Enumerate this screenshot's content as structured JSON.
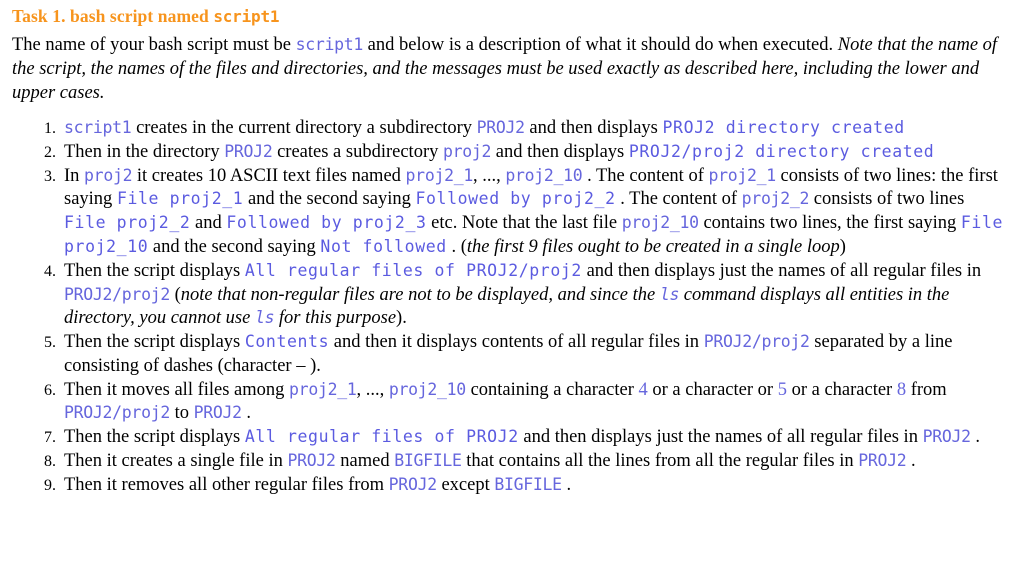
{
  "heading": {
    "prefix": "Task 1. bash script named ",
    "script_name": "script1"
  },
  "intro": {
    "seg1": "The name of your bash script must be ",
    "code1": "script1",
    "seg2": " and below is a description of what it should do when executed. ",
    "italic_note": "Note that the name of the script, the names of the files and directories, and the messages must be used exactly as described here, including the lower and upper cases."
  },
  "steps": [
    {
      "id": 1,
      "parts": [
        {
          "t": "code",
          "v": "script1"
        },
        {
          "t": "text",
          "v": " creates in the current directory a subdirectory "
        },
        {
          "t": "code",
          "v": "PROJ2"
        },
        {
          "t": "text",
          "v": " and then displays "
        },
        {
          "t": "msg",
          "v": "PROJ2 directory created"
        }
      ]
    },
    {
      "id": 2,
      "parts": [
        {
          "t": "text",
          "v": "Then in the directory "
        },
        {
          "t": "code",
          "v": "PROJ2"
        },
        {
          "t": "text",
          "v": " creates a subdirectory "
        },
        {
          "t": "code",
          "v": "proj2"
        },
        {
          "t": "text",
          "v": " and then displays "
        },
        {
          "t": "msg",
          "v": "PROJ2/proj2 directory created"
        }
      ]
    },
    {
      "id": 3,
      "parts": [
        {
          "t": "text",
          "v": "In "
        },
        {
          "t": "code",
          "v": "proj2"
        },
        {
          "t": "text",
          "v": " it creates 10 ASCII text files named "
        },
        {
          "t": "code",
          "v": "proj2_1"
        },
        {
          "t": "text",
          "v": ", ..., "
        },
        {
          "t": "code",
          "v": "proj2_10"
        },
        {
          "t": "text",
          "v": " . The content of "
        },
        {
          "t": "code",
          "v": "proj2_1"
        },
        {
          "t": "text",
          "v": " consists of two lines: the first saying "
        },
        {
          "t": "msg",
          "v": "File proj2_1"
        },
        {
          "t": "text",
          "v": " and the second saying "
        },
        {
          "t": "msg",
          "v": "Followed by proj2_2"
        },
        {
          "t": "text",
          "v": " . The content of "
        },
        {
          "t": "code",
          "v": "proj2_2"
        },
        {
          "t": "text",
          "v": " consists of two lines "
        },
        {
          "t": "msg",
          "v": "File proj2_2"
        },
        {
          "t": "text",
          "v": " and "
        },
        {
          "t": "msg",
          "v": "Followed by proj2_3"
        },
        {
          "t": "text",
          "v": " etc. Note that the last file "
        },
        {
          "t": "code",
          "v": "proj2_10"
        },
        {
          "t": "text",
          "v": " contains two lines, the first saying "
        },
        {
          "t": "msg",
          "v": "File proj2_10"
        },
        {
          "t": "text",
          "v": " and the second saying "
        },
        {
          "t": "msg",
          "v": "Not followed"
        },
        {
          "t": "text",
          "v": " . ("
        },
        {
          "t": "ital",
          "v": "the first 9 files ought to be created in a single loop"
        },
        {
          "t": "text",
          "v": ")"
        }
      ]
    },
    {
      "id": 4,
      "parts": [
        {
          "t": "text",
          "v": "Then the script displays "
        },
        {
          "t": "msg",
          "v": "All regular files of PROJ2/proj2"
        },
        {
          "t": "text",
          "v": " and then displays just the names of all regular files in "
        },
        {
          "t": "code",
          "v": "PROJ2/proj2"
        },
        {
          "t": "text",
          "v": " ("
        },
        {
          "t": "ital",
          "v": "note that non-regular files are not to be displayed, and since the "
        },
        {
          "t": "ital-code",
          "v": "ls"
        },
        {
          "t": "ital",
          "v": " command displays all entities in the directory, you cannot use "
        },
        {
          "t": "ital-code",
          "v": "ls"
        },
        {
          "t": "ital",
          "v": " for this purpose"
        },
        {
          "t": "text",
          "v": ")."
        }
      ]
    },
    {
      "id": 5,
      "parts": [
        {
          "t": "text",
          "v": "Then the script displays "
        },
        {
          "t": "msg",
          "v": "Contents"
        },
        {
          "t": "text",
          "v": " and then it displays contents of all regular files in "
        },
        {
          "t": "code",
          "v": "PROJ2/proj2"
        },
        {
          "t": "text",
          "v": " separated by a line consisting of dashes (character "
        },
        {
          "t": "text",
          "v": "– "
        },
        {
          "t": "text",
          "v": ")."
        }
      ]
    },
    {
      "id": 6,
      "parts": [
        {
          "t": "text",
          "v": "Then it moves all files among "
        },
        {
          "t": "code",
          "v": "proj2_1"
        },
        {
          "t": "text",
          "v": ", ..., "
        },
        {
          "t": "code",
          "v": "proj2_10"
        },
        {
          "t": "text",
          "v": " containing a character "
        },
        {
          "t": "num",
          "v": "4"
        },
        {
          "t": "text",
          "v": " or a character or "
        },
        {
          "t": "num",
          "v": "5"
        },
        {
          "t": "text",
          "v": " or a character "
        },
        {
          "t": "num",
          "v": "8"
        },
        {
          "t": "text",
          "v": " from "
        },
        {
          "t": "code",
          "v": "PROJ2/proj2"
        },
        {
          "t": "text",
          "v": " to "
        },
        {
          "t": "code",
          "v": "PROJ2"
        },
        {
          "t": "text",
          "v": " ."
        }
      ]
    },
    {
      "id": 7,
      "parts": [
        {
          "t": "text",
          "v": "Then the script displays "
        },
        {
          "t": "msg",
          "v": "All regular files of PROJ2"
        },
        {
          "t": "text",
          "v": " and then displays just the names of all regular files in "
        },
        {
          "t": "code",
          "v": "PROJ2"
        },
        {
          "t": "text",
          "v": " ."
        }
      ]
    },
    {
      "id": 8,
      "parts": [
        {
          "t": "text",
          "v": "Then it creates a single file in "
        },
        {
          "t": "code",
          "v": "PROJ2"
        },
        {
          "t": "text",
          "v": " named "
        },
        {
          "t": "code",
          "v": "BIGFILE"
        },
        {
          "t": "text",
          "v": " that contains all the lines from all the regular files in "
        },
        {
          "t": "code",
          "v": "PROJ2"
        },
        {
          "t": "text",
          "v": " ."
        }
      ]
    },
    {
      "id": 9,
      "parts": [
        {
          "t": "text",
          "v": "Then it removes all other regular files from "
        },
        {
          "t": "code",
          "v": "PROJ2"
        },
        {
          "t": "text",
          "v": " except "
        },
        {
          "t": "code",
          "v": "BIGFILE"
        },
        {
          "t": "text",
          "v": " ."
        }
      ]
    }
  ],
  "colors": {
    "heading": "#f7941d",
    "code": "#6666dd",
    "message": "#5b5be0",
    "body": "#000000",
    "background": "#ffffff"
  }
}
